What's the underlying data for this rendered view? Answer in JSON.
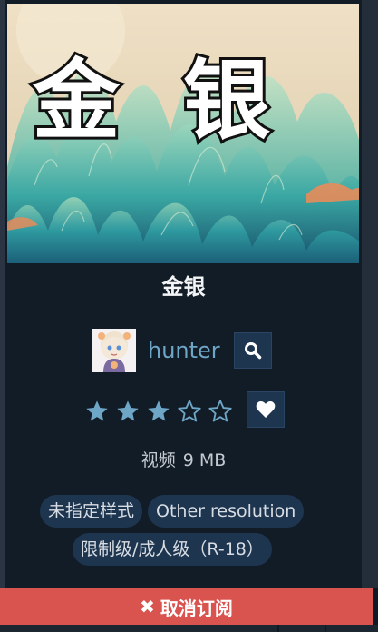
{
  "item": {
    "title": "金银",
    "cover_text": "金银",
    "author": {
      "name": "hunter"
    },
    "rating": {
      "value": 3,
      "max": 5,
      "filled_star": "★",
      "empty_star": "☆"
    },
    "meta": {
      "type": "视频",
      "size": "9 MB"
    },
    "tags": [
      "未指定样式",
      "Other resolution",
      "限制级/成人级（R-18）"
    ],
    "unsubscribe_label": "取消订阅"
  },
  "colors": {
    "background": "#0f1923",
    "accent_blue": "#6ea6c7",
    "button_bg": "#1e3550",
    "danger": "#d9534f"
  },
  "icons": {
    "search": "search-icon",
    "favorite": "heart-icon",
    "unsubscribe": "close-icon"
  }
}
